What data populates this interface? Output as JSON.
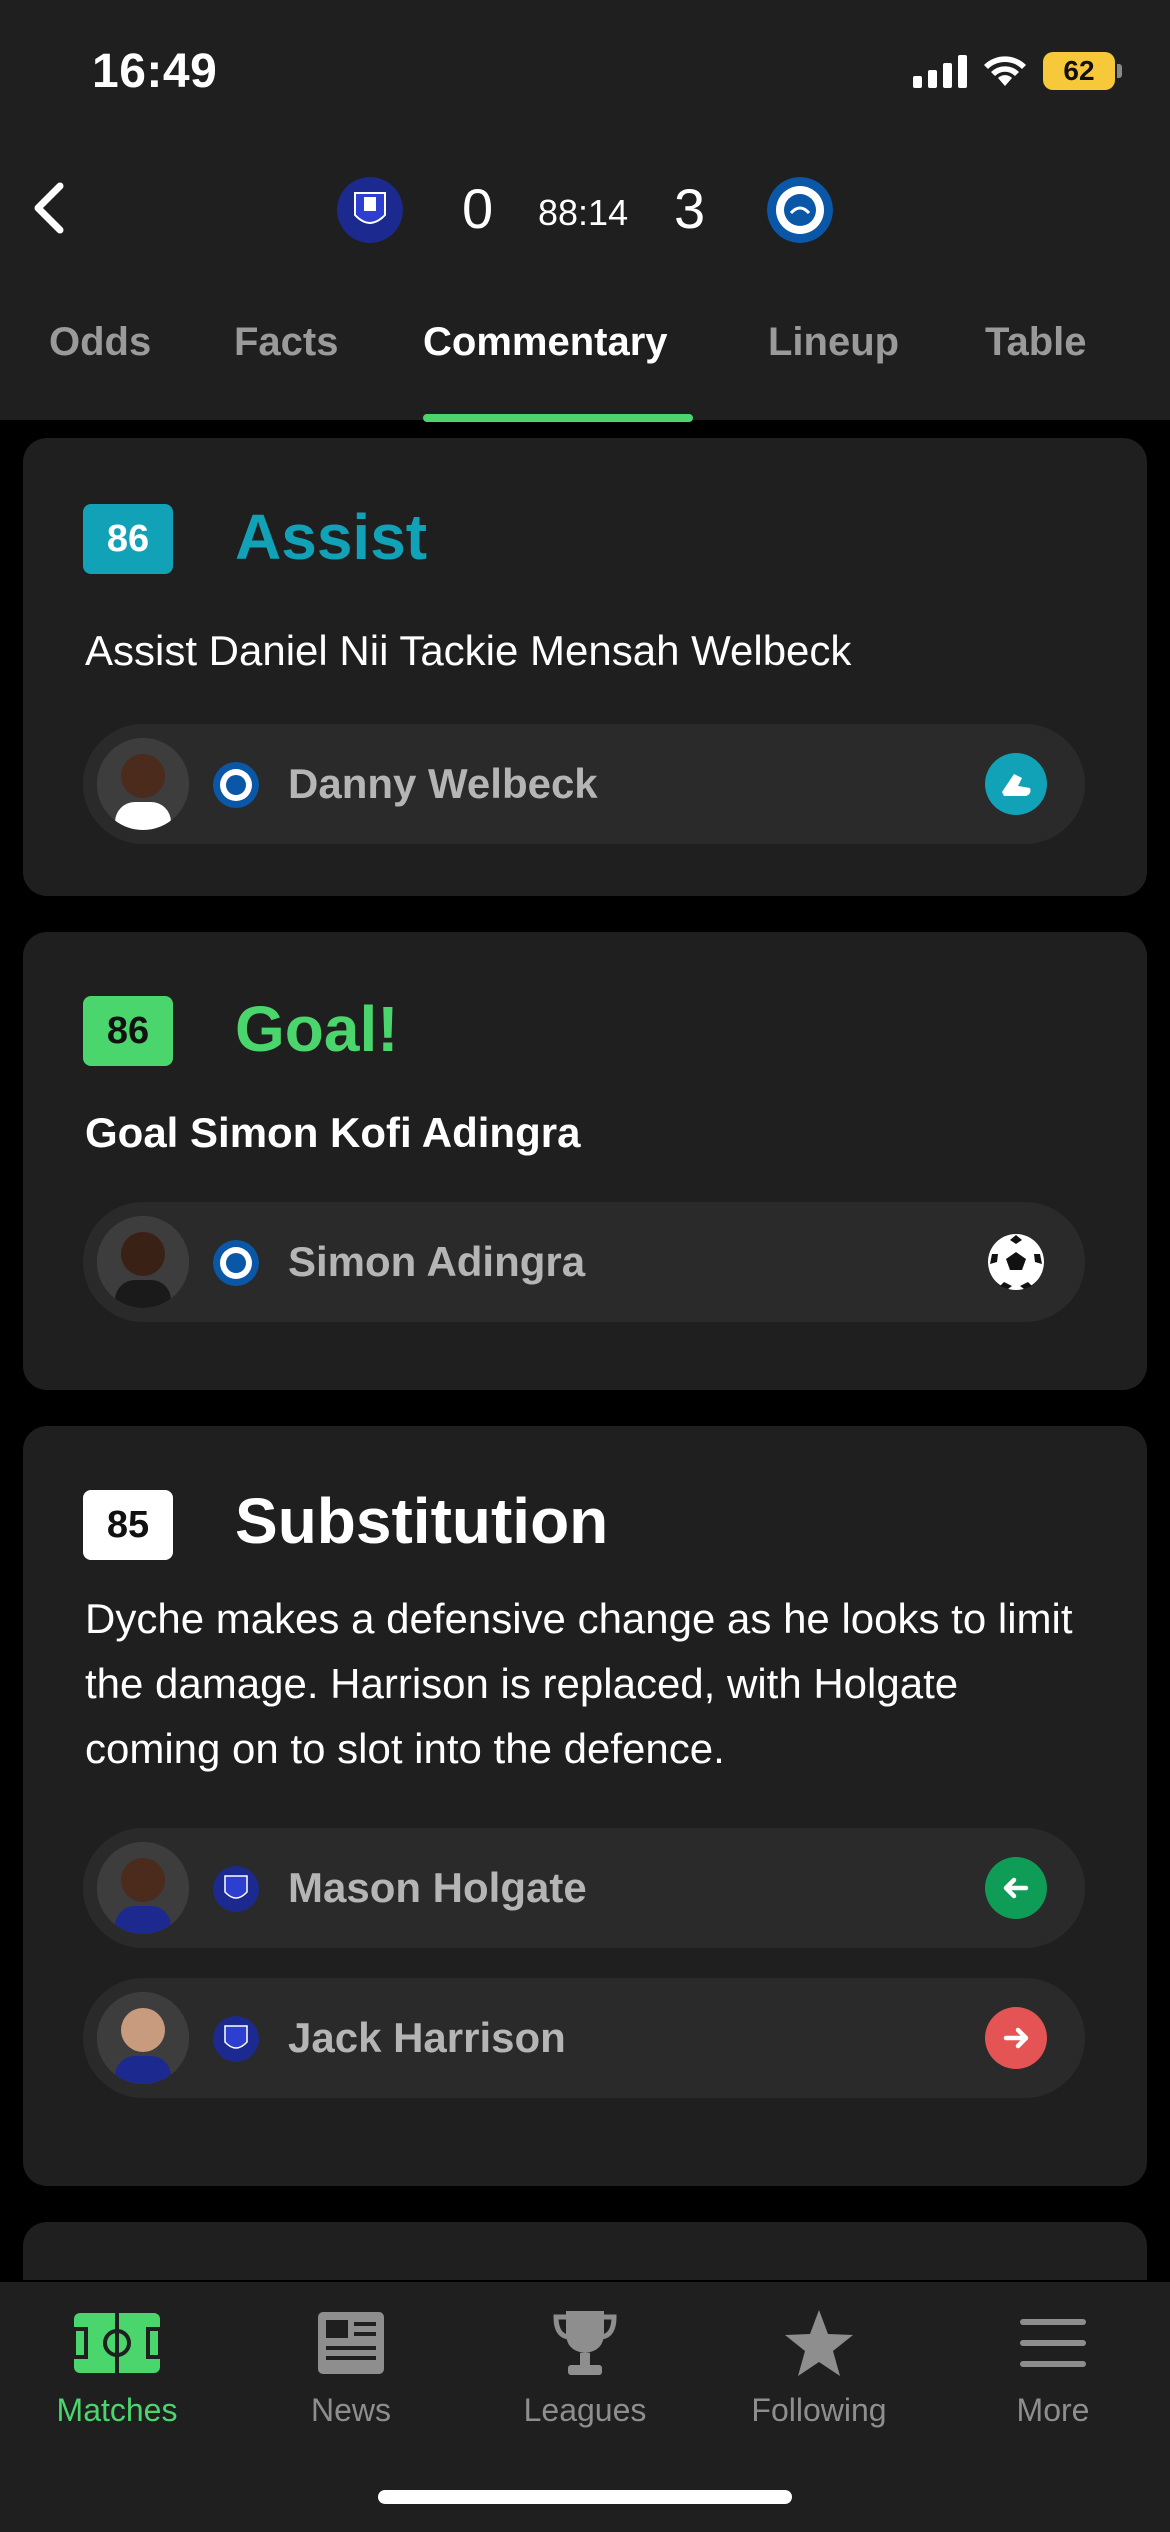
{
  "status_bar": {
    "time": "16:49",
    "battery": "62"
  },
  "header": {
    "home_score": "0",
    "away_score": "3",
    "clock": "88:14",
    "home_crest": "everton-crest",
    "away_crest": "brighton-crest"
  },
  "tabs": [
    {
      "label": "Odds"
    },
    {
      "label": "Facts"
    },
    {
      "label": "Commentary",
      "active": true
    },
    {
      "label": "Lineup"
    },
    {
      "label": "Table"
    }
  ],
  "events": [
    {
      "minute": "86",
      "title": "Assist",
      "text": "Assist Daniel Nii Tackie Mensah Welbeck",
      "color": "#12a2b8",
      "players": [
        {
          "name": "Danny Welbeck",
          "club": "brighton",
          "icon": "boot-icon"
        }
      ]
    },
    {
      "minute": "86",
      "title": "Goal!",
      "text": "Goal Simon Kofi Adingra",
      "color": "#4ad66d",
      "players": [
        {
          "name": "Simon Adingra",
          "club": "brighton",
          "icon": "ball-icon"
        }
      ]
    },
    {
      "minute": "85",
      "title": "Substitution",
      "text": "Dyche makes a defensive change as he looks to limit the damage. Harrison is replaced, with Holgate coming on to slot into the defence.",
      "color": "#ffffff",
      "players": [
        {
          "name": "Mason Holgate",
          "club": "everton",
          "icon": "sub-in-icon"
        },
        {
          "name": "Jack Harrison",
          "club": "everton",
          "icon": "sub-out-icon"
        }
      ]
    }
  ],
  "nav": [
    {
      "label": "Matches",
      "active": true
    },
    {
      "label": "News"
    },
    {
      "label": "Leagues"
    },
    {
      "label": "Following"
    },
    {
      "label": "More"
    }
  ]
}
